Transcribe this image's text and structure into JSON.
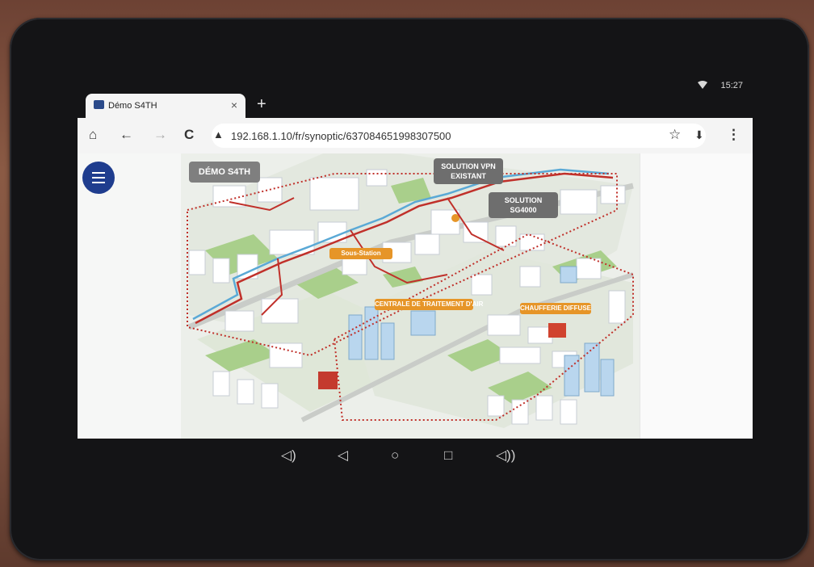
{
  "statusbar": {
    "time": "15:27"
  },
  "browser": {
    "tab_title": "Démo S4TH",
    "tab_close": "×",
    "new_tab": "+",
    "url": "192.168.1.10/fr/synoptic/637084651998307500"
  },
  "icons": {
    "home": "⌂",
    "back": "←",
    "forward": "→",
    "reload": "C",
    "warning": "▲",
    "star": "☆",
    "download": "⬇",
    "more": "⋮",
    "nav_volume_down": "◁)",
    "nav_back": "◁",
    "nav_home": "○",
    "nav_recents": "□",
    "nav_volume_up": "◁))"
  },
  "synoptic": {
    "title": "DÉMO S4TH",
    "callouts": {
      "vpn_line1": "SOLUTION VPN",
      "vpn_line2": "EXISTANT",
      "sg_line1": "SOLUTION",
      "sg_line2": "SG4000"
    },
    "tags": {
      "sous_station": "Sous-Station",
      "centrale": "CENTRALE DE TRAITEMENT D'AIR",
      "chaufferie": "CHAUFFERIE DIFFUSE"
    }
  },
  "colors": {
    "menu_button": "#1f3d8e",
    "tag_orange": "#e69528",
    "network_red": "#c0302a",
    "network_blue": "#5aa9d6",
    "callout_gray": "#6e6e6e"
  }
}
